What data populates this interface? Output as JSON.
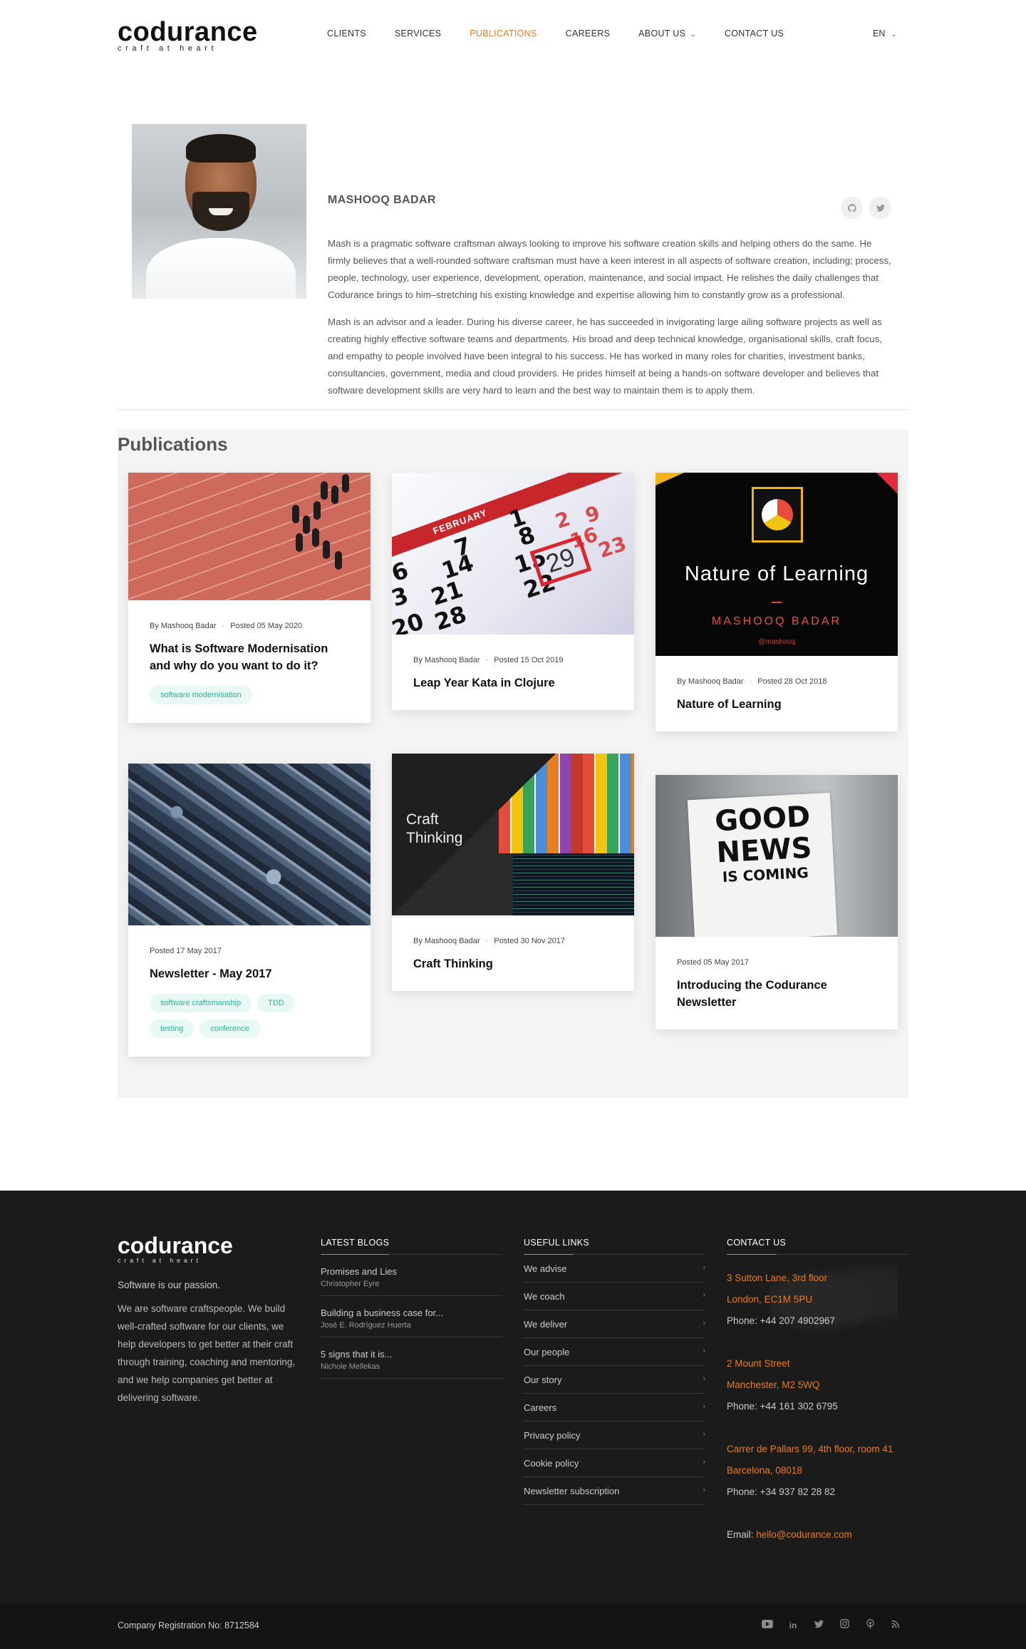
{
  "header": {
    "logo_word": "codurance",
    "logo_tagline": "craft at heart",
    "nav": [
      {
        "label": "CLIENTS",
        "active": false
      },
      {
        "label": "SERVICES",
        "active": false
      },
      {
        "label": "PUBLICATIONS",
        "active": true
      },
      {
        "label": "CAREERS",
        "active": false
      },
      {
        "label": "ABOUT US",
        "active": false,
        "has_dropdown": true
      },
      {
        "label": "CONTACT US",
        "active": false
      }
    ],
    "language": "EN"
  },
  "author": {
    "name": "MASHOOQ BADAR",
    "social_icons": [
      "github-icon",
      "twitter-icon"
    ],
    "bio": [
      "Mash is a pragmatic software craftsman always looking to improve his software creation skills and helping others do the same. He firmly believes that a well-rounded software craftsman must have a keen interest in all aspects of software creation, including; process, people, technology, user experience, development, operation, maintenance, and social impact. He relishes the daily challenges that Codurance brings to him–stretching his existing knowledge and expertise allowing him to constantly grow as a professional.",
      "Mash is an advisor and a leader. During his diverse career, he has succeeded in invigorating large ailing software projects as well as creating highly effective software teams and departments. His broad and deep technical knowledge, organisational skills, craft focus, and empathy to people involved have been integral to his success. He has worked in many roles for charities, investment banks, consultancies, government, media and cloud providers. He prides himself at being a hands-on software developer and believes that software development skills are very hard to learn and the best way to maintain them is to apply them."
    ]
  },
  "publications": {
    "title": "Publications",
    "cards": [
      {
        "author": "By Mashooq Badar",
        "posted": "Posted 05 May 2020",
        "title": "What is Software Modernisation and why do you want to do it?",
        "tags": [
          "software modernisation"
        ]
      },
      {
        "author": "By Mashooq Badar",
        "posted": "Posted 15 Oct 2019",
        "title": "Leap Year Kata in Clojure",
        "tags": [],
        "image_text": {
          "month": "FEBRUARY",
          "highlight": "29"
        }
      },
      {
        "author": "By Mashooq Badar",
        "posted": "Posted 28 Oct 2018",
        "title": "Nature of Learning",
        "tags": [],
        "image_text": {
          "heading": "Nature of Learning",
          "name": "MASHOOQ BADAR",
          "handle": "@mashooq"
        }
      },
      {
        "author": "",
        "posted": "Posted 17 May 2017",
        "title": "Newsletter - May 2017",
        "tags": [
          "software craftsmanship",
          "TDD",
          "testing",
          "conference"
        ]
      },
      {
        "author": "By Mashooq Badar",
        "posted": "Posted 30 Nov 2017",
        "title": "Craft Thinking",
        "tags": [],
        "image_text": {
          "line1": "Craft",
          "line2": "Thinking"
        }
      },
      {
        "author": "",
        "posted": "Posted 05 May 2017",
        "title": "Introducing the Codurance Newsletter",
        "tags": [],
        "image_text": {
          "line1": "GOOD",
          "line2": "NEWS",
          "line3": "IS COMING"
        }
      }
    ]
  },
  "footer": {
    "logo_word": "codurance",
    "logo_tagline": "craft at heart",
    "tagline": "Software is our passion.",
    "about": "We are software craftspeople. We build well-crafted software for our clients, we help developers to get better at their craft through training, coaching and mentoring, and we help companies get better at delivering software.",
    "blogs_heading": "LATEST BLOGS",
    "blogs": [
      {
        "title": "Promises and Lies",
        "author": "Christopher Eyre"
      },
      {
        "title": "Building a business case for...",
        "author": "José E. Rodríguez Huerta"
      },
      {
        "title": "5 signs that it is...",
        "author": "Nichole Mellekas"
      }
    ],
    "links_heading": "USEFUL LINKS",
    "links": [
      "We advise",
      "We coach",
      "We deliver",
      "Our people",
      "Our story",
      "Careers",
      "Privacy policy",
      "Cookie policy",
      "Newsletter subscription"
    ],
    "contact_heading": "CONTACT US",
    "offices": [
      {
        "line1": "3 Sutton Lane, 3rd floor",
        "line2": "London, EC1M 5PU",
        "phone": "Phone: +44 207 4902967"
      },
      {
        "line1": "2 Mount Street",
        "line2": "Manchester, M2 5WQ",
        "phone": "Phone: +44 161 302 6795"
      },
      {
        "line1": "Carrer de Pallars 99, 4th floor, room 41",
        "line2": "Barcelona, 08018",
        "phone": "Phone: +34 937 82 28 82"
      }
    ],
    "email_label": "Email: ",
    "email": "hello@codurance.com"
  },
  "bottom_bar": {
    "registration": "Company Registration No: 8712584",
    "social_icons": [
      "youtube-icon",
      "linkedin-icon",
      "twitter-icon",
      "instagram-icon",
      "podcast-icon",
      "rss-icon"
    ]
  },
  "colors": {
    "accent": "#e67e22",
    "tag_text": "#29b39a",
    "footer_bg": "#1b1b1b"
  }
}
